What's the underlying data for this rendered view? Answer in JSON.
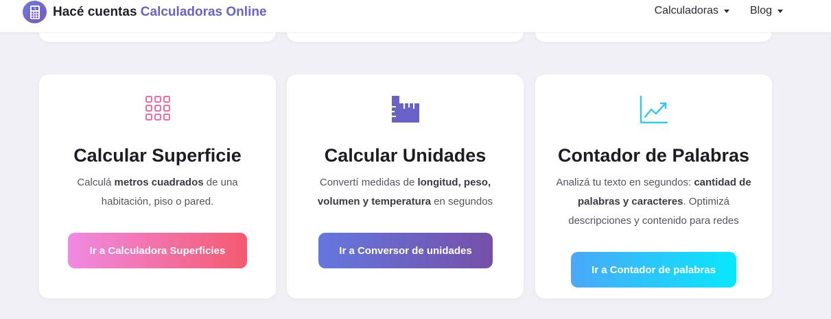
{
  "header": {
    "brand_prefix": "Hacé cuentas",
    "brand_accent": "Calculadoras Online",
    "logo_icon": "calculator-percent-icon",
    "nav": [
      {
        "label": "Calculadoras",
        "icon": "caret-down-icon"
      },
      {
        "label": "Blog",
        "icon": "caret-down-icon"
      }
    ]
  },
  "cards": [
    {
      "icon": "grid-icon",
      "icon_color": "#f06ba8",
      "title": "Calcular Superficie",
      "desc_parts": [
        "Calculá ",
        "metros cuadrados",
        " de una habitación, piso o pared."
      ],
      "button": "Ir a Calculadora Superficies"
    },
    {
      "icon": "ruler-icon",
      "icon_color": "#6a62c9",
      "title": "Calcular Unidades",
      "desc_parts": [
        "Convertí medidas de ",
        "longitud, peso, volumen y temperatura",
        " en segundos"
      ],
      "button": "Ir a Conversor de unidades"
    },
    {
      "icon": "trend-chart-icon",
      "icon_color": "#2fc6f0",
      "title": "Contador de Palabras",
      "desc_parts": [
        "Analizá tu texto en segundos: ",
        "cantidad de palabras y caracteres",
        ". Optimizá descripciones y contenido para redes"
      ],
      "button": "Ir a Contador de palabras"
    }
  ],
  "colors": {
    "background": "#f0f0f6",
    "brand_accent": "#6a62c9",
    "btn_superficie": [
      "#f08ae3",
      "#f45a6f"
    ],
    "btn_unidades": [
      "#6477df",
      "#7550a8"
    ],
    "btn_palabras": [
      "#4aa8f8",
      "#07e8fc"
    ]
  }
}
